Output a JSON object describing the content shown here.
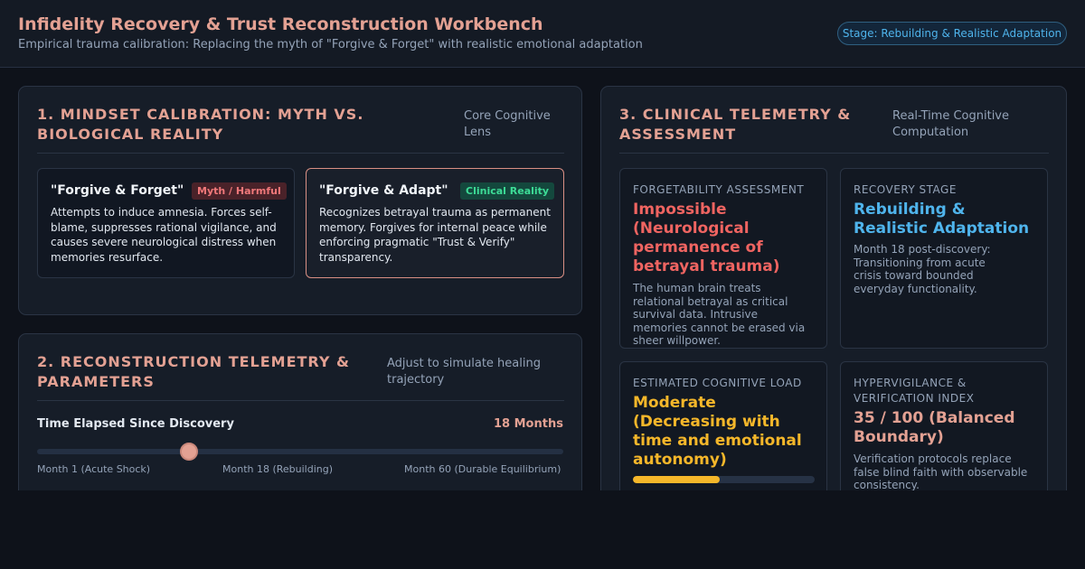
{
  "app": {
    "title": "Infidelity Recovery & Trust Reconstruction Workbench",
    "subtitle": "Empirical trauma calibration: Replacing the myth of \"Forgive & Forget\" with realistic emotional adaptation",
    "stage_badge": "Stage: Rebuilding & Realistic Adaptation"
  },
  "mindset": {
    "title": "1. MINDSET CALIBRATION: MYTH VS. BIOLOGICAL REALITY",
    "note": "Core Cognitive Lens",
    "myth": {
      "title": "\"Forgive & Forget\"",
      "badge": "Myth / Harmful",
      "body": "Attempts to induce amnesia. Forces self-blame, suppresses rational vigilance, and causes severe neurological distress when memories resurface."
    },
    "reality": {
      "title": "\"Forgive & Adapt\"",
      "badge": "Clinical Reality",
      "body": "Recognizes betrayal trauma as permanent memory. Forgives for internal peace while enforcing pragmatic \"Trust & Verify\" transparency."
    }
  },
  "telemetry": {
    "title": "2. RECONSTRUCTION TELEMETRY & PARAMETERS",
    "note": "Adjust to simulate healing trajectory",
    "slider": {
      "label": "Time Elapsed Since Discovery",
      "value_text": "18 Months",
      "value": 18,
      "min": 1,
      "max": 60,
      "ticks": [
        "Month 1 (Acute Shock)",
        "Month 18 (Rebuilding)",
        "Month 60 (Durable Equilibrium)"
      ]
    }
  },
  "assessment": {
    "title": "3. CLINICAL TELEMETRY & ASSESSMENT",
    "note": "Real-Time Cognitive Computation",
    "forgetability": {
      "label": "FORGETABILITY ASSESSMENT",
      "value": "Impossible (Neurological permanence of betrayal trauma)",
      "desc": "The human brain treats relational betrayal as critical survival data. Intrusive memories cannot be erased via sheer willpower.",
      "color": "#ef6461"
    },
    "stage": {
      "label": "RECOVERY STAGE",
      "value": "Rebuilding & Realistic Adaptation",
      "desc": "Month 18 post-discovery: Transitioning from acute crisis toward bounded everyday functionality.",
      "color": "#4fb4ec"
    },
    "load": {
      "label": "ESTIMATED COGNITIVE LOAD",
      "value": "Moderate (Decreasing with time and emotional autonomy)",
      "level": 0.48,
      "color": "#f5b72a"
    },
    "vigilance": {
      "label": "HYPERVIGILANCE & VERIFICATION INDEX",
      "value": "35 / 100 (Balanced Boundary)",
      "desc": "Verification protocols replace false blind faith with observable consistency.",
      "color": "#e3a193"
    }
  }
}
